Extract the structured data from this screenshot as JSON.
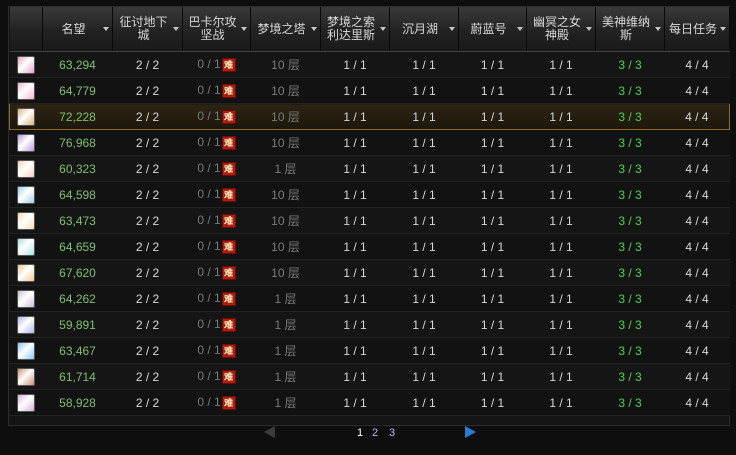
{
  "colors": {
    "selected_border": "#8a6b2c",
    "reputation": "#7fc06f",
    "complete_green": "#49d649",
    "badge_red": "#b01c10",
    "pager_arrow_active": "#2a7ad8"
  },
  "headers": [
    {
      "key": "avatar",
      "label": ""
    },
    {
      "key": "reputation",
      "label": "名望"
    },
    {
      "key": "conquest",
      "label": "征讨地下城"
    },
    {
      "key": "bakal",
      "label": "巴卡尔攻坚战"
    },
    {
      "key": "dream_tower",
      "label": "梦境之塔"
    },
    {
      "key": "dream_solidaris",
      "label": "梦境之索利达里斯"
    },
    {
      "key": "moon_lake",
      "label": "沉月湖"
    },
    {
      "key": "blue_ship",
      "label": "蔚蓝号"
    },
    {
      "key": "underworld",
      "label": "幽冥之女神殿"
    },
    {
      "key": "venus",
      "label": "美神维纳斯"
    },
    {
      "key": "daily",
      "label": "每日任务"
    }
  ],
  "badge_text": "难",
  "rows": [
    {
      "avatar": "#e7a3c9",
      "reputation": "63,294",
      "conquest": "2 / 2",
      "bakal": "0 / 1",
      "dream_tower": "10 层",
      "dream_solidaris": "1 / 1",
      "moon_lake": "1 / 1",
      "blue_ship": "1 / 1",
      "underworld": "1 / 1",
      "venus": "3 / 3",
      "daily": "4 / 4"
    },
    {
      "avatar": "#f0b8d8",
      "reputation": "64,779",
      "conquest": "2 / 2",
      "bakal": "0 / 1",
      "dream_tower": "10 层",
      "dream_solidaris": "1 / 1",
      "moon_lake": "1 / 1",
      "blue_ship": "1 / 1",
      "underworld": "1 / 1",
      "venus": "3 / 3",
      "daily": "4 / 4"
    },
    {
      "avatar": "#d9b37a",
      "reputation": "72,228",
      "conquest": "2 / 2",
      "bakal": "0 / 1",
      "dream_tower": "10 层",
      "dream_solidaris": "1 / 1",
      "moon_lake": "1 / 1",
      "blue_ship": "1 / 1",
      "underworld": "1 / 1",
      "venus": "3 / 3",
      "daily": "4 / 4",
      "selected": true
    },
    {
      "avatar": "#b89ad8",
      "reputation": "76,968",
      "conquest": "2 / 2",
      "bakal": "0 / 1",
      "dream_tower": "10 层",
      "dream_solidaris": "1 / 1",
      "moon_lake": "1 / 1",
      "blue_ship": "1 / 1",
      "underworld": "1 / 1",
      "venus": "3 / 3",
      "daily": "4 / 4"
    },
    {
      "avatar": "#f2d2c0",
      "reputation": "60,323",
      "conquest": "2 / 2",
      "bakal": "0 / 1",
      "dream_tower": "1 层",
      "dream_solidaris": "1 / 1",
      "moon_lake": "1 / 1",
      "blue_ship": "1 / 1",
      "underworld": "1 / 1",
      "venus": "3 / 3",
      "daily": "4 / 4"
    },
    {
      "avatar": "#9ed0e8",
      "reputation": "64,598",
      "conquest": "2 / 2",
      "bakal": "0 / 1",
      "dream_tower": "10 层",
      "dream_solidaris": "1 / 1",
      "moon_lake": "1 / 1",
      "blue_ship": "1 / 1",
      "underworld": "1 / 1",
      "venus": "3 / 3",
      "daily": "4 / 4"
    },
    {
      "avatar": "#f0e0b0",
      "reputation": "63,473",
      "conquest": "2 / 2",
      "bakal": "0 / 1",
      "dream_tower": "10 层",
      "dream_solidaris": "1 / 1",
      "moon_lake": "1 / 1",
      "blue_ship": "1 / 1",
      "underworld": "1 / 1",
      "venus": "3 / 3",
      "daily": "4 / 4"
    },
    {
      "avatar": "#a8e0e0",
      "reputation": "64,659",
      "conquest": "2 / 2",
      "bakal": "0 / 1",
      "dream_tower": "10 层",
      "dream_solidaris": "1 / 1",
      "moon_lake": "1 / 1",
      "blue_ship": "1 / 1",
      "underworld": "1 / 1",
      "venus": "3 / 3",
      "daily": "4 / 4"
    },
    {
      "avatar": "#f0c890",
      "reputation": "67,620",
      "conquest": "2 / 2",
      "bakal": "0 / 1",
      "dream_tower": "10 层",
      "dream_solidaris": "1 / 1",
      "moon_lake": "1 / 1",
      "blue_ship": "1 / 1",
      "underworld": "1 / 1",
      "venus": "3 / 3",
      "daily": "4 / 4"
    },
    {
      "avatar": "#c8c0d8",
      "reputation": "64,262",
      "conquest": "2 / 2",
      "bakal": "0 / 1",
      "dream_tower": "1 层",
      "dream_solidaris": "1 / 1",
      "moon_lake": "1 / 1",
      "blue_ship": "1 / 1",
      "underworld": "1 / 1",
      "venus": "3 / 3",
      "daily": "4 / 4"
    },
    {
      "avatar": "#b0b8e8",
      "reputation": "59,891",
      "conquest": "2 / 2",
      "bakal": "0 / 1",
      "dream_tower": "1 层",
      "dream_solidaris": "1 / 1",
      "moon_lake": "1 / 1",
      "blue_ship": "1 / 1",
      "underworld": "1 / 1",
      "venus": "3 / 3",
      "daily": "4 / 4"
    },
    {
      "avatar": "#88c8f0",
      "reputation": "63,467",
      "conquest": "2 / 2",
      "bakal": "0 / 1",
      "dream_tower": "1 层",
      "dream_solidaris": "1 / 1",
      "moon_lake": "1 / 1",
      "blue_ship": "1 / 1",
      "underworld": "1 / 1",
      "venus": "3 / 3",
      "daily": "4 / 4"
    },
    {
      "avatar": "#c89070",
      "reputation": "61,714",
      "conquest": "2 / 2",
      "bakal": "0 / 1",
      "dream_tower": "1 层",
      "dream_solidaris": "1 / 1",
      "moon_lake": "1 / 1",
      "blue_ship": "1 / 1",
      "underworld": "1 / 1",
      "venus": "3 / 3",
      "daily": "4 / 4"
    },
    {
      "avatar": "#d8b0d8",
      "reputation": "58,928",
      "conquest": "2 / 2",
      "bakal": "0 / 1",
      "dream_tower": "1 层",
      "dream_solidaris": "1 / 1",
      "moon_lake": "1 / 1",
      "blue_ship": "1 / 1",
      "underworld": "1 / 1",
      "venus": "3 / 3",
      "daily": "4 / 4"
    }
  ],
  "pagination": {
    "pages": [
      "1",
      "2",
      "3"
    ],
    "current": "1",
    "prev_icon": "arrow-left-icon",
    "next_icon": "arrow-right-icon"
  }
}
